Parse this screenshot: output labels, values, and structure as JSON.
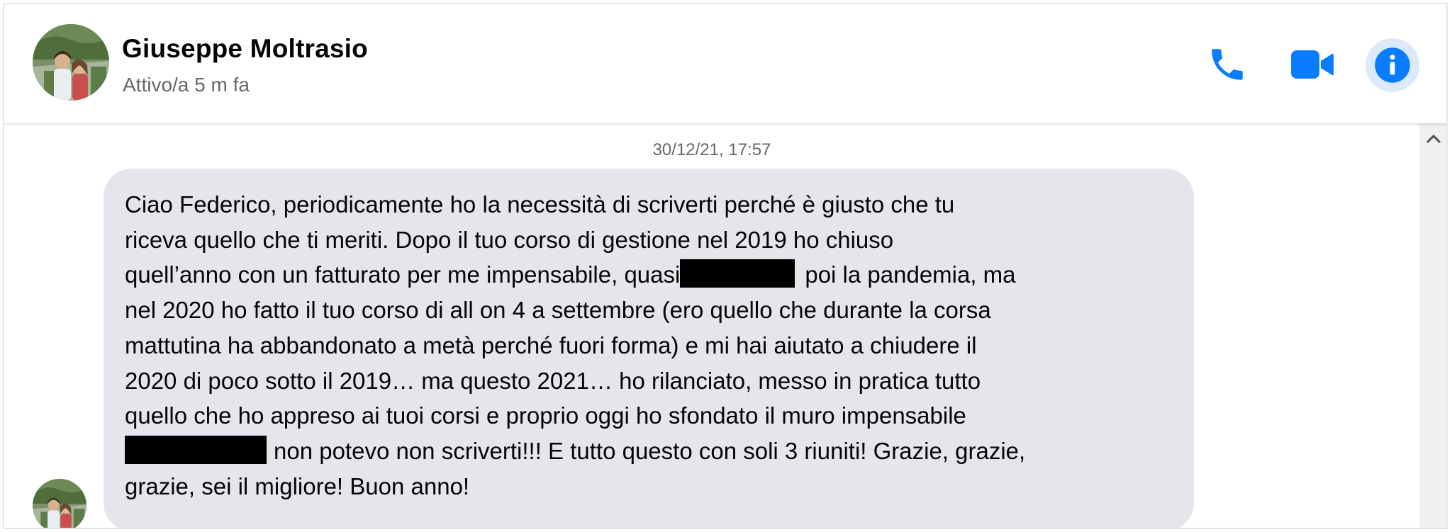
{
  "contact": {
    "name": "Giuseppe Moltrasio",
    "status": "Attivo/a 5 m fa"
  },
  "header": {
    "icons": [
      "phone-icon",
      "video-camera-icon",
      "info-icon"
    ]
  },
  "chat": {
    "timestamp": "30/12/21, 17:57",
    "message_lines": [
      "Ciao Federico, periodicamente ho la necessità di scriverti perché è giusto che tu",
      "riceva quello che ti meriti. Dopo il tuo corso di gestione nel 2019 ho chiuso",
      "quell’anno con un fatturato per me impensabile, quasi",
      "poi la pandemia, ma",
      "nel 2020 ho fatto il tuo corso di all on 4 a settembre (ero quello che durante la corsa",
      "mattutina ha abbandonato a metà perché fuori forma) e mi hai aiutato a chiudere il",
      "2020 di poco sotto il 2019… ma questo 2021… ho rilanciato, messo in pratica tutto",
      "quello che ho appreso ai tuoi corsi e proprio oggi ho sfondato il muro impensabile",
      "non potevo non scriverti!!! E tutto questo con soli 3 riuniti! Grazie, grazie,",
      "grazie, sei il migliore! Buon anno!"
    ]
  },
  "colors": {
    "accent": "#0a7cff",
    "bubble": "#e4e6eb",
    "secondary_text": "#65676b",
    "info_bg": "#dbe9fb"
  }
}
